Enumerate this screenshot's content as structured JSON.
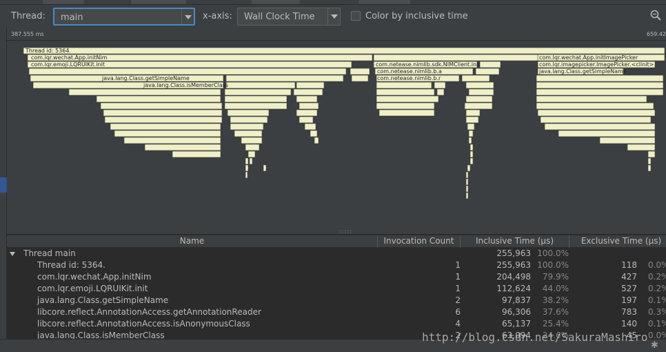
{
  "toolbar": {
    "thread_label": "Thread:",
    "thread_value": "main",
    "xaxis_label": "x-axis:",
    "xaxis_value": "Wall Clock Time",
    "color_by_label": "Color by inclusive time",
    "color_by_checked": false
  },
  "timebar": {
    "start": "387.555 ms",
    "end": "659.42"
  },
  "flame": {
    "bar_color": "#f0f0c8",
    "labels": [
      "Thread id: 5364.",
      "com.lqr.wechat.App.initNim",
      "com.lqr.emoji.LQRUIKit.init",
      "java.lang.Class.getSimpleName",
      "java.lang.Class.isMemberClass",
      "com.netease.nimlib.sdk.NIMClient.init",
      "com.netease.nimlib.b.a",
      "com.netease.nimlib.b.r",
      "com.lqr.wechat.App.initImagePicker",
      "com.lqr.imagepicker.ImagePicker.<clinit>",
      "java.lang.Class.getSimpleName"
    ]
  },
  "table": {
    "columns": [
      "Name",
      "Invocation Count",
      "Inclusive Time (µs)",
      "Exclusive Time (µs)"
    ],
    "group": {
      "name": "Thread main",
      "inclusive": "255,963",
      "inclusive_pct": "100.0%"
    },
    "rows": [
      {
        "name": "Thread id: 5364.",
        "count": "1",
        "inclusive": "255,963",
        "inclusive_pct": "100.0%",
        "exclusive": "118",
        "exclusive_pct": "0.0%"
      },
      {
        "name": "com.lqr.wechat.App.initNim",
        "count": "1",
        "inclusive": "204,498",
        "inclusive_pct": "79.9%",
        "exclusive": "427",
        "exclusive_pct": "0.2%"
      },
      {
        "name": "com.lqr.emoji.LQRUIKit.init",
        "count": "1",
        "inclusive": "112,624",
        "inclusive_pct": "44.0%",
        "exclusive": "527",
        "exclusive_pct": "0.2%"
      },
      {
        "name": "java.lang.Class.getSimpleName",
        "count": "2",
        "inclusive": "97,837",
        "inclusive_pct": "38.2%",
        "exclusive": "197",
        "exclusive_pct": "0.1%"
      },
      {
        "name": "libcore.reflect.AnnotationAccess.getAnnotationReader",
        "count": "6",
        "inclusive": "96,306",
        "inclusive_pct": "37.6%",
        "exclusive": "783",
        "exclusive_pct": "0.3%"
      },
      {
        "name": "libcore.reflect.AnnotationAccess.isAnonymousClass",
        "count": "4",
        "inclusive": "65,137",
        "inclusive_pct": "25.4%",
        "exclusive": "140",
        "exclusive_pct": "0.1%"
      },
      {
        "name": "java.lang.Class.isMemberClass",
        "count": "2",
        "inclusive": "63,094",
        "inclusive_pct": "24.6%",
        "exclusive": "45",
        "exclusive_pct": "0.0%"
      }
    ]
  },
  "watermark": "http://blog.csdn.net/SakuraMashiro"
}
